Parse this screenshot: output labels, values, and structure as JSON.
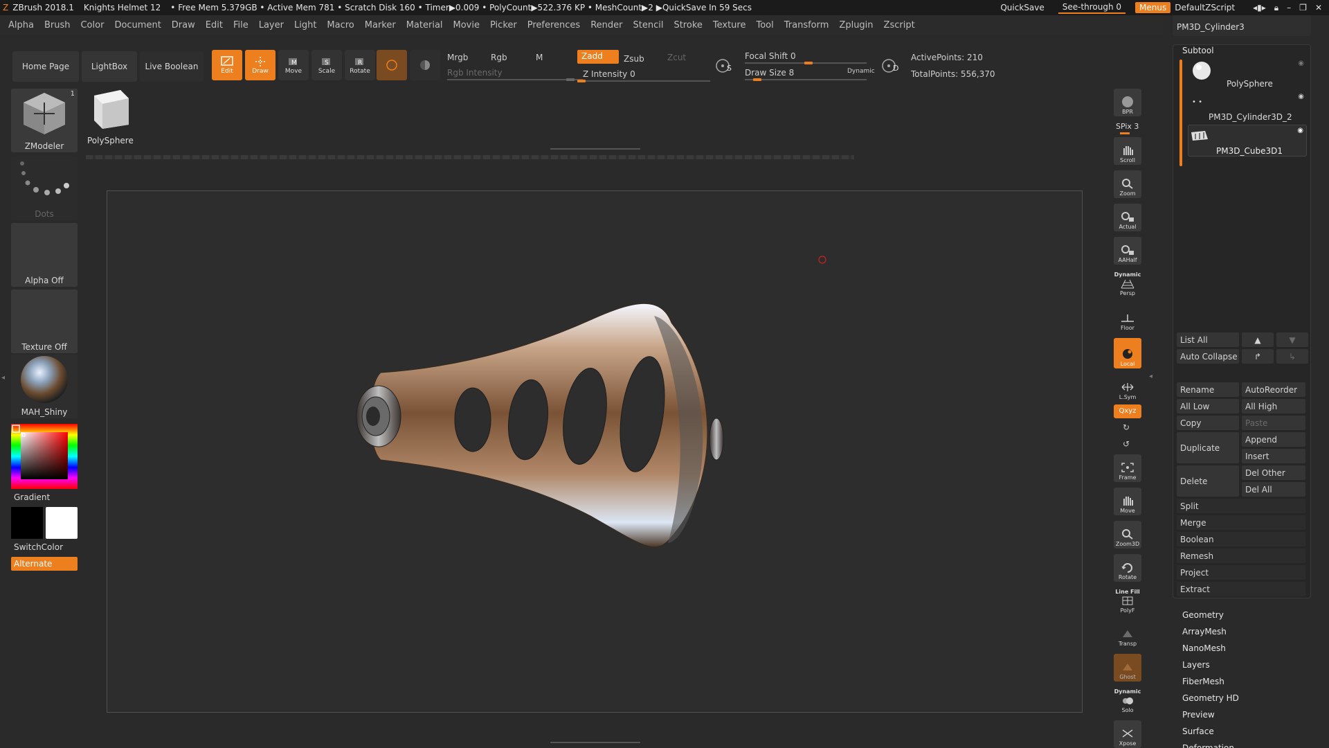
{
  "titlebar": {
    "app": "ZBrush 2018.1",
    "doc": "Knights Helmet 12",
    "stats": "• Free Mem 5.379GB • Active Mem 781 • Scratch Disk 160 • Timer▶0.009 • PolyCount▶522.376 KP • MeshCount▶2 ▶QuickSave In 59 Secs",
    "quicksave": "QuickSave",
    "seethrough": "See-through  0",
    "menus": "Menus",
    "script": "DefaultZScript",
    "top_tool": "PM3D_Cylinder3"
  },
  "menubar": [
    "Alpha",
    "Brush",
    "Color",
    "Document",
    "Draw",
    "Edit",
    "File",
    "Layer",
    "Light",
    "Macro",
    "Marker",
    "Material",
    "Movie",
    "Picker",
    "Preferences",
    "Render",
    "Stencil",
    "Stroke",
    "Texture",
    "Tool",
    "Transform",
    "Zplugin",
    "Zscript"
  ],
  "toolbar": {
    "home": "Home Page",
    "lightbox": "LightBox",
    "liveboolean": "Live Boolean",
    "edit": "Edit",
    "draw": "Draw",
    "move": "Move",
    "scale": "Scale",
    "rotate": "Rotate",
    "mrgb": "Mrgb",
    "rgb": "Rgb",
    "m": "M",
    "rgb_intensity": "Rgb Intensity",
    "zadd": "Zadd",
    "zsub": "Zsub",
    "zcut": "Zcut",
    "z_intensity": "Z Intensity 0",
    "focal_shift": "Focal Shift 0",
    "draw_size": "Draw Size 8",
    "dynamic": "Dynamic",
    "active_points": "ActivePoints: 210",
    "total_points": "TotalPoints: 556,370",
    "s_icon_letter": "S",
    "d_icon_letter": "D"
  },
  "left": {
    "brush": "ZModeler",
    "brush_count": "1",
    "tool_thumb": "PolySphere",
    "stroke": "Dots",
    "alpha": "Alpha Off",
    "texture": "Texture Off",
    "material": "MAH_Shiny",
    "gradient": "Gradient",
    "switchcolor": "SwitchColor",
    "alternate": "Alternate"
  },
  "right_toolbar": {
    "bpr": "BPR",
    "spix": "SPix 3",
    "scroll": "Scroll",
    "zoom": "Zoom",
    "actual": "Actual",
    "aahalf": "AAHalf",
    "dynamic_label": "Dynamic",
    "persp": "Persp",
    "floor": "Floor",
    "local": "Local",
    "lsym": "L.Sym",
    "xyz": "Qxyz",
    "frame": "Frame",
    "move": "Move",
    "zoom3d": "Zoom3D",
    "rotate": "Rotate",
    "linefill": "Line Fill",
    "polyf": "PolyF",
    "transp": "Transp",
    "ghost": "Ghost",
    "dynamic2": "Dynamic",
    "solo": "Solo",
    "xpose": "Xpose"
  },
  "subtool": {
    "header": "Subtool",
    "items": [
      "PolySphere",
      "PM3D_Cylinder3D_2",
      "PM3D_Cube3D1"
    ],
    "list_all": "List All",
    "auto_collapse": "Auto Collapse",
    "rename": "Rename",
    "autoreorder": "AutoReorder",
    "all_low": "All Low",
    "all_high": "All High",
    "copy": "Copy",
    "paste": "Paste",
    "duplicate": "Duplicate",
    "append": "Append",
    "insert": "Insert",
    "delete": "Delete",
    "del_other": "Del Other",
    "del_all": "Del All",
    "split": "Split",
    "merge": "Merge",
    "boolean": "Boolean",
    "remesh": "Remesh",
    "project": "Project",
    "extract": "Extract"
  },
  "tool_sections": [
    "Geometry",
    "ArrayMesh",
    "NanoMesh",
    "Layers",
    "FiberMesh",
    "Geometry HD",
    "Preview",
    "Surface",
    "Deformation"
  ],
  "colors": {
    "accent": "#ee7f1e",
    "bg": "#2a2a2a",
    "panel": "#262626"
  }
}
